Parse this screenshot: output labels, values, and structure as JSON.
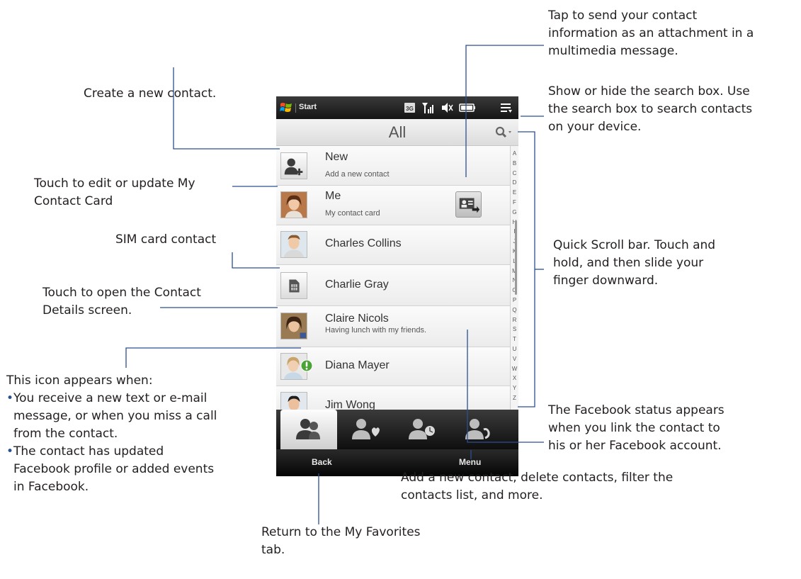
{
  "status_bar": {
    "start_label": "Start",
    "icons": [
      "windows-logo-icon",
      "network-3g-icon",
      "signal-icon",
      "speaker-off-icon",
      "battery-icon",
      "connectivity-icon"
    ]
  },
  "title_bar": {
    "title": "All",
    "search_toggle_icon": "search-icon"
  },
  "contacts": [
    {
      "name": "New",
      "subtitle": "Add a new contact",
      "icon": "add-contact-icon"
    },
    {
      "name": "Me",
      "subtitle": "My contact card",
      "icon": "avatar-photo",
      "action_icon": "send-contact-card-icon"
    },
    {
      "name": "Charles Collins",
      "subtitle": "",
      "icon": "avatar-photo"
    },
    {
      "name": "Charlie Gray",
      "subtitle": "",
      "icon": "sim-card-icon"
    },
    {
      "name": "Claire Nicols",
      "subtitle": "Having lunch with my friends.",
      "icon": "avatar-photo"
    },
    {
      "name": "Diana Mayer",
      "subtitle": "",
      "icon": "avatar-photo",
      "badge_icon": "update-alert-icon"
    },
    {
      "name": "Jim Wong",
      "subtitle": "",
      "icon": "avatar-photo"
    }
  ],
  "quick_scroll_letters": [
    "A",
    "B",
    "C",
    "D",
    "E",
    "F",
    "G",
    "H",
    "I",
    "J",
    "K",
    "L",
    "M",
    "N",
    "O",
    "P",
    "Q",
    "R",
    "S",
    "T",
    "U",
    "V",
    "W",
    "X",
    "Y",
    "Z"
  ],
  "tabs": [
    {
      "icon": "all-contacts-icon",
      "active": true
    },
    {
      "icon": "favorites-icon",
      "active": false
    },
    {
      "icon": "recent-contacts-icon",
      "active": false
    },
    {
      "icon": "updates-events-icon",
      "active": false
    }
  ],
  "softkeys": {
    "left": "Back",
    "right": "Menu"
  },
  "annotations": {
    "send_card": [
      "Tap to send your contact",
      "information as an attachment in a",
      "multimedia message."
    ],
    "new_contact": [
      "Create a new contact."
    ],
    "search_box": [
      "Show or hide the search box. Use",
      "the search box to search contacts",
      "on your device."
    ],
    "my_card": [
      "Touch to edit or update My",
      "Contact Card"
    ],
    "sim_contact": [
      "SIM card contact"
    ],
    "quick_scroll": [
      "Quick Scroll bar. Touch and",
      "hold, and then slide your",
      "finger downward."
    ],
    "contact_details": [
      "Touch to open the Contact",
      "Details screen."
    ],
    "icon_appears": {
      "heading": "This icon appears when:",
      "bullets": [
        [
          "You receive a new text or e-mail",
          "message, or when you miss a call",
          "from the contact."
        ],
        [
          "The contact has updated",
          "Facebook profile or added events",
          "in Facebook."
        ]
      ]
    },
    "facebook_status": [
      "The Facebook status appears",
      "when you link the contact to",
      "his or her Facebook account."
    ],
    "menu": [
      "Add a new contact, delete contacts, filter the",
      "contacts list, and more."
    ],
    "back": [
      "Return to the My Favorites",
      "tab."
    ]
  },
  "colors": {
    "leader_line": "#2a4f8f",
    "annotation_text": "#231f20",
    "bullet": "#2a4f8f"
  }
}
